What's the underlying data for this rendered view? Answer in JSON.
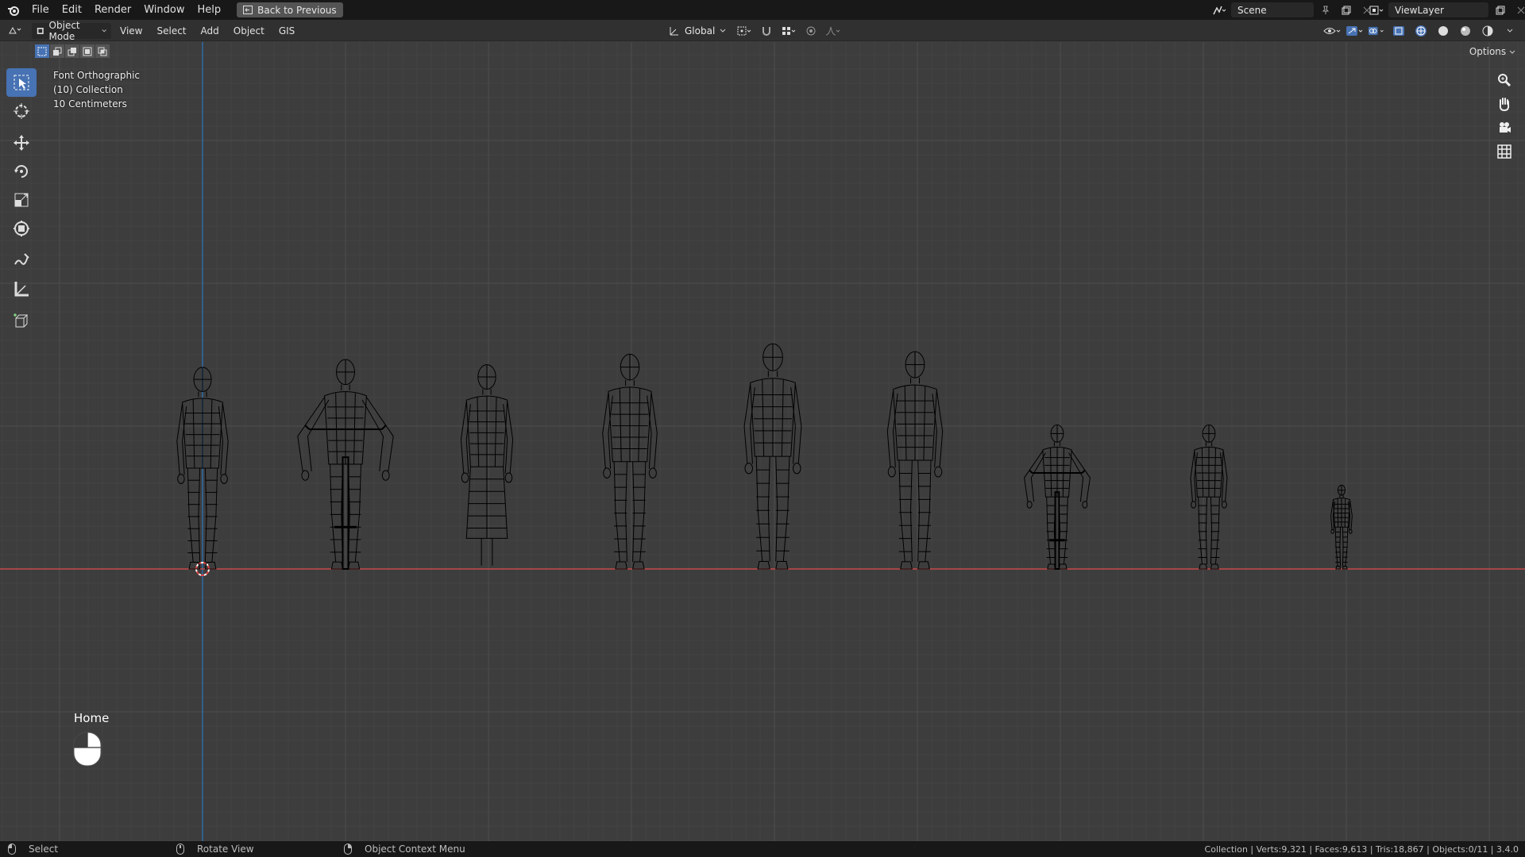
{
  "topbar": {
    "menus": [
      "File",
      "Edit",
      "Render",
      "Window",
      "Help"
    ],
    "back_label": "Back to Previous",
    "scene_name": "Scene",
    "viewlayer_name": "ViewLayer"
  },
  "header": {
    "mode": "Object Mode",
    "menus": [
      "View",
      "Select",
      "Add",
      "Object",
      "GIS"
    ],
    "orientation": "Global"
  },
  "viewport": {
    "view_name": "Font Orthographic",
    "collection": "(10) Collection",
    "scale": "10 Centimeters",
    "options_label": "Options",
    "hint_label": "Home",
    "figures": [
      {
        "kind": "walking-woman-icon",
        "height": 0.77
      },
      {
        "kind": "cyclist-icon",
        "height": 0.8
      },
      {
        "kind": "woman-dress-icon",
        "height": 0.78
      },
      {
        "kind": "walking-man-icon",
        "height": 0.82
      },
      {
        "kind": "standing-man-icon",
        "height": 0.86
      },
      {
        "kind": "walking-man-icon",
        "height": 0.83
      },
      {
        "kind": "child-cyclist-icon",
        "height": 0.55
      },
      {
        "kind": "child-walking-icon",
        "height": 0.55
      },
      {
        "kind": "toddler-icon",
        "height": 0.32
      }
    ]
  },
  "status": {
    "select": "Select",
    "rotate": "Rotate View",
    "context": "Object Context Menu",
    "stats": "Collection | Verts:9,321 | Faces:9,613 | Tris:18,867 | Objects:0/11 | 3.4.0"
  },
  "colors": {
    "viewport_bg": "#3d3d3d",
    "x_axis": "#c74a4a",
    "z_axis": "#2e6ba8",
    "active_tool": "#4772b3",
    "wire": "#000000"
  }
}
